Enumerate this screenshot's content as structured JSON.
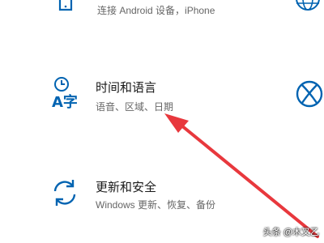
{
  "tiles": {
    "phone": {
      "description": "连接 Android 设备，iPhone",
      "icon": "phone-icon"
    },
    "time_language": {
      "title": "时间和语言",
      "description": "语音、区域、日期",
      "icon": "time-language-icon",
      "icon_text": "A字"
    },
    "update_security": {
      "title": "更新和安全",
      "description": "Windows 更新、恢复、备份",
      "icon": "sync-icon"
    }
  },
  "right_column": {
    "network_icon": "globe-icon",
    "gaming_icon": "xbox-icon"
  },
  "annotation": {
    "color": "#e8383d"
  },
  "watermark": "头条 @木又乙",
  "accent_color": "#0063b1"
}
